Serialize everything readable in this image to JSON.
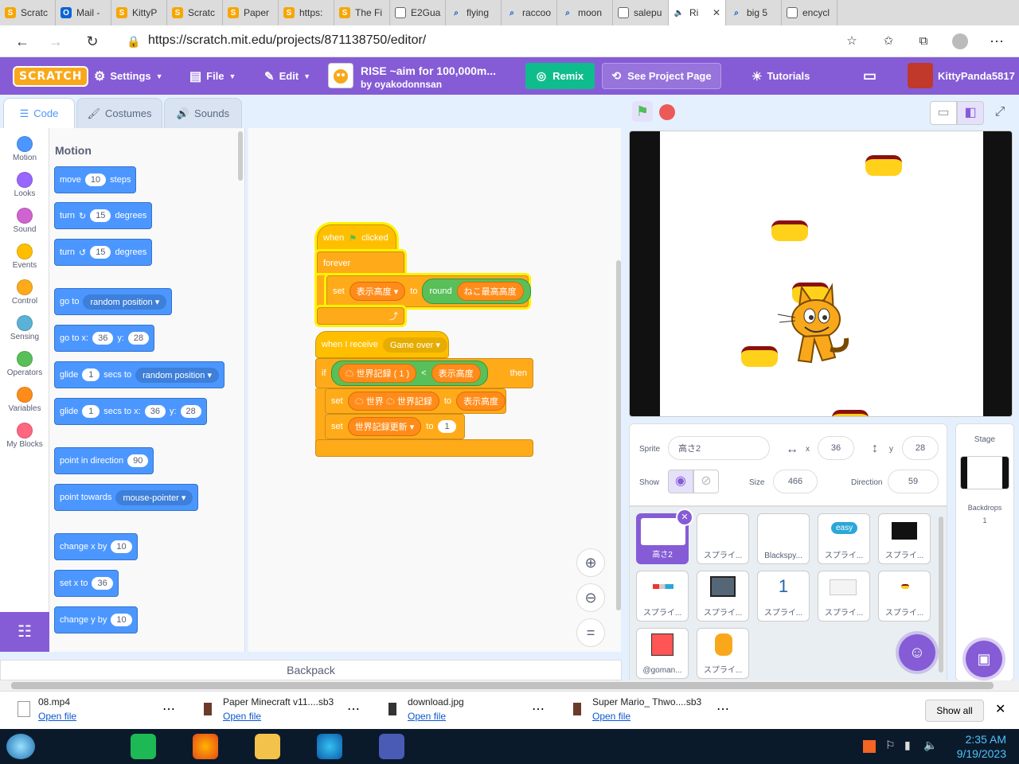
{
  "browser": {
    "tabs": [
      {
        "label": "Scratc",
        "icon": "scratch-icon"
      },
      {
        "label": "Mail -",
        "icon": "outlook-icon"
      },
      {
        "label": "KittyP",
        "icon": "scratch-icon"
      },
      {
        "label": "Scratc",
        "icon": "scratch-icon"
      },
      {
        "label": "Paper",
        "icon": "scratch-icon"
      },
      {
        "label": "https:",
        "icon": "scratch-icon"
      },
      {
        "label": "The Fi",
        "icon": "scratch-icon"
      },
      {
        "label": "E2Gua",
        "icon": "doc-icon"
      },
      {
        "label": "flying",
        "icon": "search-icon"
      },
      {
        "label": "raccoo",
        "icon": "search-icon"
      },
      {
        "label": "moon",
        "icon": "search-icon"
      },
      {
        "label": "salepu",
        "icon": "doc-icon"
      },
      {
        "label": "Ri",
        "icon": "speaker-icon"
      },
      {
        "label": "big 5",
        "icon": "search-icon"
      },
      {
        "label": "encycl",
        "icon": "doc-icon"
      }
    ],
    "url": "https://scratch.mit.edu/projects/871138750/editor/"
  },
  "menubar": {
    "logo": "SCRATCH",
    "settings": "Settings",
    "file": "File",
    "edit": "Edit",
    "project_title": "RISE ~aim for 100,000m...",
    "project_author": "by oyakodonnsan",
    "remix": "Remix",
    "see_project_page": "See Project Page",
    "tutorials": "Tutorials",
    "username": "KittyPanda5817"
  },
  "editor_tabs": {
    "code": "Code",
    "costumes": "Costumes",
    "sounds": "Sounds"
  },
  "categories": [
    {
      "label": "Motion",
      "color": "#4c97ff"
    },
    {
      "label": "Looks",
      "color": "#9966ff"
    },
    {
      "label": "Sound",
      "color": "#cf63cf"
    },
    {
      "label": "Events",
      "color": "#ffbf00"
    },
    {
      "label": "Control",
      "color": "#ffab19"
    },
    {
      "label": "Sensing",
      "color": "#5cb1d6"
    },
    {
      "label": "Operators",
      "color": "#59c059"
    },
    {
      "label": "Variables",
      "color": "#ff8c1a"
    },
    {
      "label": "My Blocks",
      "color": "#ff6680"
    }
  ],
  "palette": {
    "heading": "Motion",
    "move": {
      "a": "move",
      "v": "10",
      "b": "steps"
    },
    "turn_right": {
      "a": "turn",
      "v": "15",
      "b": "degrees"
    },
    "turn_left": {
      "a": "turn",
      "v": "15",
      "b": "degrees"
    },
    "goto": {
      "a": "go to",
      "d": "random position"
    },
    "gotoxy": {
      "a": "go to x:",
      "x": "36",
      "yl": "y:",
      "y": "28"
    },
    "glide_to": {
      "a": "glide",
      "v": "1",
      "b": "secs to",
      "d": "random position"
    },
    "glide_xy": {
      "a": "glide",
      "v": "1",
      "b": "secs to x:",
      "x": "36",
      "yl": "y:",
      "y": "28"
    },
    "point_dir": {
      "a": "point in direction",
      "v": "90"
    },
    "point_towards": {
      "a": "point towards",
      "d": "mouse-pointer"
    },
    "change_x": {
      "a": "change x by",
      "v": "10"
    },
    "set_x": {
      "a": "set x to",
      "v": "36"
    },
    "change_y": {
      "a": "change y by",
      "v": "10"
    }
  },
  "scripts": {
    "s1": {
      "when": "when",
      "clicked": "clicked",
      "forever": "forever",
      "set": "set",
      "var": "表示高度",
      "to": "to",
      "round": "round",
      "reporter": "ねこ最高高度"
    },
    "s2": {
      "when_receive": "when I receive",
      "msg": "Game over",
      "if": "if",
      "then": "then",
      "cond_left": "☁ 世界記録 ( 1 )",
      "lt": "<",
      "cond_right": "表示高度",
      "set1": "set",
      "set1_var": "☁ 世界",
      "set1_var2": "☁ 世界記録",
      "set1_to": "to",
      "set1_val": "表示高度",
      "set2": "set",
      "set2_var": "世界記録更新",
      "set2_to": "to",
      "set2_val": "1"
    }
  },
  "backpack": "Backpack",
  "sprite_info": {
    "sprite_label": "Sprite",
    "sprite_name": "高さ2",
    "x_label": "x",
    "x": "36",
    "y_label": "y",
    "y": "28",
    "show_label": "Show",
    "size_label": "Size",
    "size": "466",
    "direction_label": "Direction",
    "direction": "59"
  },
  "sprites": [
    {
      "name": "高さ2"
    },
    {
      "name": "スプライ..."
    },
    {
      "name": "Blackspy..."
    },
    {
      "name": "スプライ...",
      "badge": "easy"
    },
    {
      "name": "スプライ..."
    },
    {
      "name": "スプライ..."
    },
    {
      "name": "スプライ..."
    },
    {
      "name": "スプライ...",
      "digit": "1"
    },
    {
      "name": "スプライ..."
    },
    {
      "name": "スプライ..."
    },
    {
      "name": "@goman..."
    },
    {
      "name": "スプライ..."
    }
  ],
  "stage_panel": {
    "title": "Stage",
    "backdrops_label": "Backdrops",
    "backdrops_count": "1"
  },
  "downloads": [
    {
      "name": "08.mp4",
      "action": "Open file"
    },
    {
      "name": "Paper Minecraft v11....sb3",
      "action": "Open file"
    },
    {
      "name": "download.jpg",
      "action": "Open file"
    },
    {
      "name": "Super Mario_ Thwo....sb3",
      "action": "Open file"
    }
  ],
  "downloads_show_all": "Show all",
  "taskbar": {
    "time": "2:35 AM",
    "date": "9/19/2023"
  }
}
